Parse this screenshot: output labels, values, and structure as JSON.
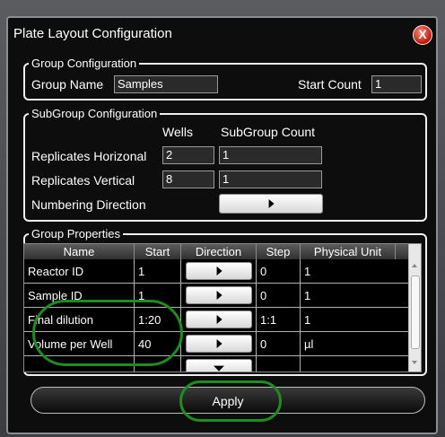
{
  "window": {
    "title": "Plate Layout Configuration",
    "close_symbol": "X"
  },
  "group_config": {
    "legend": "Group Configuration",
    "group_name_label": "Group Name",
    "group_name_value": "Samples",
    "start_count_label": "Start Count",
    "start_count_value": "1"
  },
  "subgroup_config": {
    "legend": "SubGroup Configuration",
    "col_wells": "Wells",
    "col_subgroup_count": "SubGroup Count",
    "rows": [
      {
        "label": "Replicates Horizonal",
        "wells": "2",
        "subgroup_count": "1"
      },
      {
        "label": "Replicates Vertical",
        "wells": "8",
        "subgroup_count": "1"
      }
    ],
    "numbering_direction_label": "Numbering Direction",
    "numbering_direction_icon": "arrow-right-icon"
  },
  "group_properties": {
    "legend": "Group Properties",
    "columns": [
      "Name",
      "Start",
      "Direction",
      "Step",
      "Physical Unit"
    ],
    "rows": [
      {
        "name": "Reactor ID",
        "start": "1",
        "direction": "right",
        "step": "0",
        "unit": "1"
      },
      {
        "name": "Sample ID",
        "start": "1",
        "direction": "right",
        "step": "0",
        "unit": "1"
      },
      {
        "name": "Final dilution",
        "start": "1:20",
        "direction": "right",
        "step": "1:1",
        "unit": "1"
      },
      {
        "name": "Volume per Well",
        "start": "40",
        "direction": "right",
        "step": "0",
        "unit": "µl"
      },
      {
        "name": "",
        "start": "",
        "direction": "down",
        "step": "",
        "unit": ""
      }
    ]
  },
  "apply_label": "Apply",
  "annotation_color": "#1f8c1f"
}
